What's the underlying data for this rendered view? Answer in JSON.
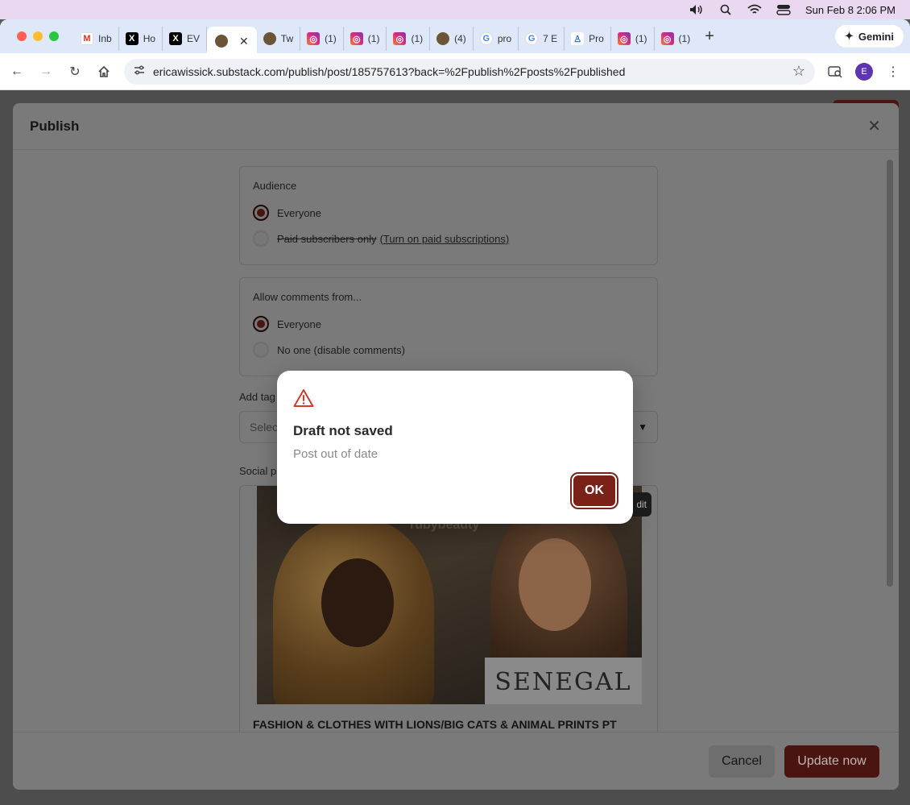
{
  "menubar": {
    "datetime": "Sun Feb 8  2:06 PM"
  },
  "browser": {
    "tabs": [
      {
        "icon": "gmail-icon",
        "label": "Inb"
      },
      {
        "icon": "x-icon",
        "label": "Ho"
      },
      {
        "icon": "x-icon",
        "label": "EV"
      },
      {
        "icon": "substack-icon",
        "label": "",
        "active": true
      },
      {
        "icon": "substack-icon",
        "label": "Tw"
      },
      {
        "icon": "instagram-icon",
        "label": "(1)"
      },
      {
        "icon": "instagram-icon",
        "label": "(1)"
      },
      {
        "icon": "instagram-icon",
        "label": "(1)"
      },
      {
        "icon": "substack-icon",
        "label": "(4)"
      },
      {
        "icon": "google-icon",
        "label": "pro"
      },
      {
        "icon": "google-icon",
        "label": "7 E"
      },
      {
        "icon": "pr-icon",
        "label": "Pro"
      },
      {
        "icon": "instagram-icon",
        "label": "(1)"
      },
      {
        "icon": "instagram-icon",
        "label": "(1)"
      }
    ],
    "gemini_label": "Gemini",
    "url": "ericawissick.substack.com/publish/post/185757613?back=%2Fpublish%2Fposts%2Fpublished",
    "profile_initial": "E"
  },
  "publish": {
    "title": "Publish",
    "audience": {
      "label": "Audience",
      "options": [
        {
          "label": "Everyone",
          "selected": true
        },
        {
          "label": "Paid subscribers only",
          "link": "(Turn on paid subscriptions)",
          "selected": false
        }
      ]
    },
    "comments": {
      "label": "Allow comments from...",
      "options": [
        {
          "label": "Everyone",
          "selected": true
        },
        {
          "label": "No one (disable comments)",
          "selected": false
        }
      ]
    },
    "tags_label": "Add tag",
    "tags_placeholder": "Selec",
    "social_label": "Social p",
    "social_edit": "dit",
    "social_image_watermark": "rubybeauty",
    "social_image_sign": "SENEGAL",
    "social_title": "FASHION & CLOTHES WITH LIONS/BIG CATS & ANIMAL PRINTS PT",
    "cancel_label": "Cancel",
    "update_label": "Update now"
  },
  "alert": {
    "title": "Draft not saved",
    "message": "Post out of date",
    "ok_label": "OK"
  },
  "colors": {
    "accent": "#7a2217",
    "tab_strip": "#dee8f8",
    "menubar": "#e9d8f0"
  }
}
